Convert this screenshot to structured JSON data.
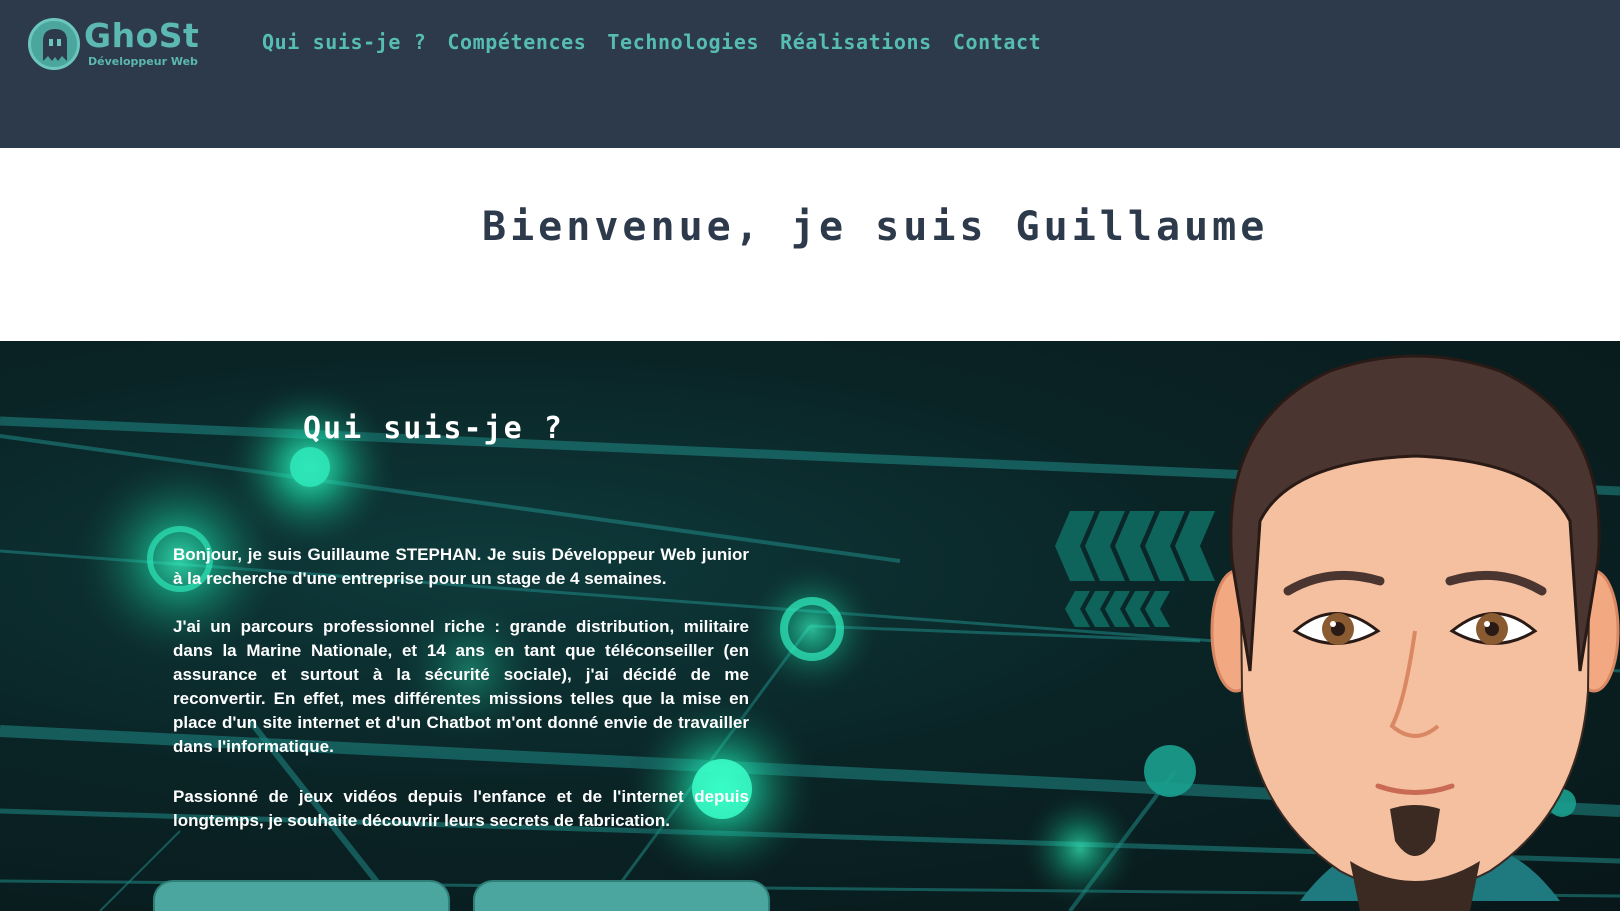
{
  "header": {
    "logo": {
      "name": "GhoSt",
      "tagline": "Développeur Web",
      "icon": "ghost-icon"
    },
    "nav": [
      {
        "label": "Qui suis-je ?"
      },
      {
        "label": "Compétences"
      },
      {
        "label": "Technologies"
      },
      {
        "label": "Réalisations"
      },
      {
        "label": "Contact"
      }
    ]
  },
  "welcome": {
    "title": "Bienvenue, je suis Guillaume"
  },
  "about": {
    "title": "Qui suis-je ?",
    "paragraphs": [
      "Bonjour, je suis Guillaume STEPHAN. Je suis Développeur Web junior à la recherche d'une entreprise pour un stage de 4 semaines.",
      "J'ai un parcours professionnel riche : grande distribution, militaire dans la Marine Nationale, et 14 ans en tant que téléconseiller (en assurance et surtout à la sécurité sociale), j'ai décidé de me reconvertir. En effet, mes différentes missions telles que la mise en place d'un site internet et d'un Chatbot m'ont donné envie de travailler dans l'informatique.",
      "Passionné de jeux vidéos depuis l'enfance et de l'internet depuis longtemps, je souhaite découvrir leurs secrets de fabrication."
    ]
  },
  "colors": {
    "header_bg": "#2d3a4b",
    "accent": "#56bdb4",
    "hero_bg": "#0a2426",
    "glow": "#2ee6b8"
  }
}
